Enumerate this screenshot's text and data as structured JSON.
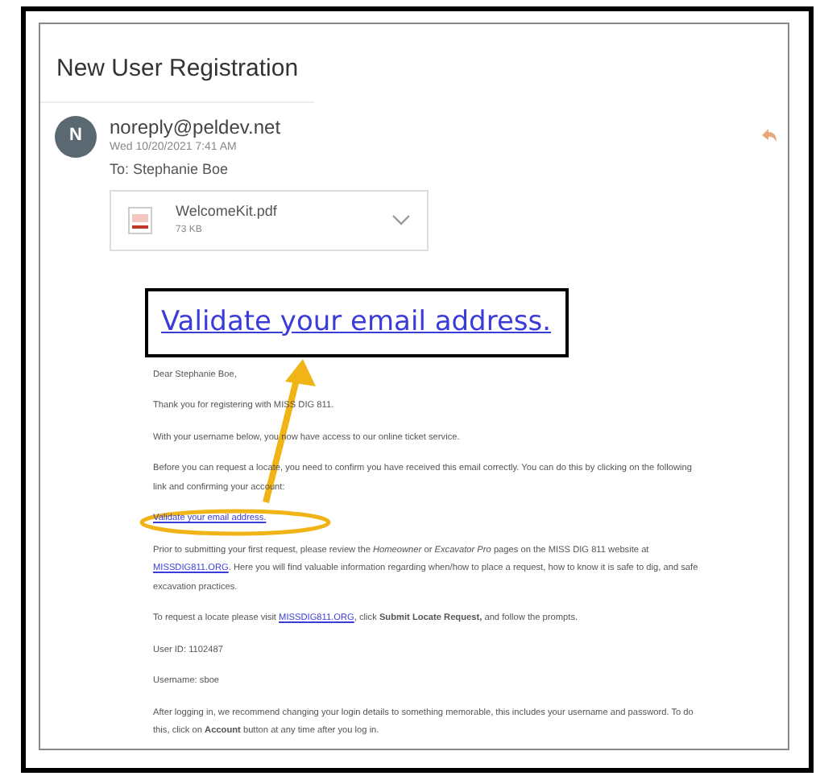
{
  "email": {
    "subject": "New User Registration",
    "avatar_letter": "N",
    "sender": "noreply@peldev.net",
    "date": "Wed 10/20/2021 7:41 AM",
    "to": "To:  Stephanie Boe",
    "attachment": {
      "name": "WelcomeKit.pdf",
      "size": "73 KB"
    },
    "body": [
      {
        "segments": [
          {
            "kind": "text",
            "text": "Dear Stephanie Boe,"
          }
        ]
      },
      {
        "segments": [
          {
            "kind": "text",
            "text": "Thank you for registering with MISS DIG 811."
          }
        ]
      },
      {
        "segments": [
          {
            "kind": "text",
            "text": "With your username below, you now have access to our online ticket service."
          }
        ]
      },
      {
        "segments": [
          {
            "kind": "text",
            "text": "Before you can request a locate, you need to confirm you have received this email correctly. You can do this by clicking on the following link and confirming your account:"
          }
        ]
      },
      {
        "segments": [
          {
            "kind": "link",
            "text": "Validate your email address."
          }
        ]
      },
      {
        "segments": [
          {
            "kind": "text",
            "text": "Prior to submitting your first request, please review the *Homeowner* or *Excavator Pro* pages on the MISS DIG 811 website at "
          },
          {
            "kind": "link",
            "text": "MISSDIG811.ORG"
          },
          {
            "kind": "text",
            "text": ". Here you will find valuable information regarding when/how to place a request, how to know it is safe to dig, and safe excavation practices."
          }
        ]
      },
      {
        "segments": [
          {
            "kind": "text",
            "text": "To request a locate please visit "
          },
          {
            "kind": "link",
            "text": "MISSDIG811.ORG"
          },
          {
            "kind": "text",
            "text": ", click **Submit Locate Request,** and follow the prompts."
          }
        ]
      },
      {
        "segments": [
          {
            "kind": "text",
            "text": "User ID:  1102487"
          }
        ]
      },
      {
        "segments": [
          {
            "kind": "text",
            "text": "Username:  sboe"
          }
        ]
      },
      {
        "segments": [
          {
            "kind": "text",
            "text": "After logging in, we recommend changing your login details to something memorable, this includes your username and password. To do this, click on **Account** button at any time after you log in."
          }
        ]
      }
    ]
  },
  "callout": {
    "text": "Validate your email address."
  }
}
